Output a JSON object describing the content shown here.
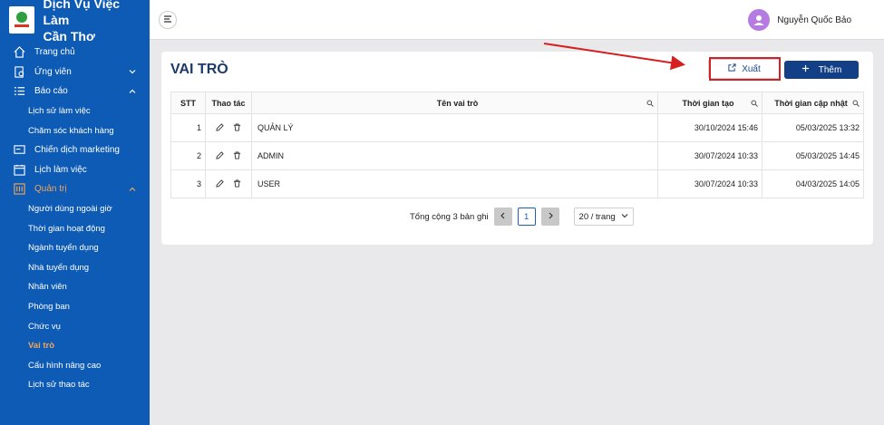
{
  "brand": {
    "title_line1": "Dịch Vụ Việc Làm",
    "title_line2": "Cần Thơ"
  },
  "nav": {
    "items": [
      {
        "label": "Trang chủ",
        "icon": "home-icon"
      },
      {
        "label": "Ứng viên",
        "icon": "candidate-icon"
      },
      {
        "label": "Báo cáo",
        "icon": "list-icon"
      }
    ],
    "report_subitems": [
      "Lịch sử làm việc",
      "Chăm sóc khách hàng"
    ],
    "items2": [
      {
        "label": "Chiến dịch marketing",
        "icon": "campaign-icon"
      },
      {
        "label": "Lịch làm việc",
        "icon": "calendar-icon"
      },
      {
        "label": "Quản trị",
        "icon": "admin-icon"
      }
    ],
    "admin_subitems": [
      "Người dùng ngoài giờ",
      "Thời gian hoạt động",
      "Ngành tuyển dụng",
      "Nhà tuyển dụng",
      "Nhân viên",
      "Phòng ban",
      "Chức vụ",
      "Vai trò",
      "Cấu hình nâng cao",
      "Lịch sử thao tác"
    ]
  },
  "user": {
    "name": "Nguyễn Quốc Bảo"
  },
  "page": {
    "title": "VAI TRÒ",
    "export_label": "Xuất",
    "add_label": "Thêm"
  },
  "table": {
    "headers": {
      "stt": "STT",
      "actions": "Thao tác",
      "name": "Tên vai trò",
      "created": "Thời gian tạo",
      "updated": "Thời gian cập nhật"
    },
    "rows": [
      {
        "stt": "1",
        "name": "QUẢN LÝ",
        "created": "30/10/2024 15:46",
        "updated": "05/03/2025 13:32"
      },
      {
        "stt": "2",
        "name": "ADMIN",
        "created": "30/07/2024 10:33",
        "updated": "05/03/2025 14:45"
      },
      {
        "stt": "3",
        "name": "USER",
        "created": "30/07/2024 10:33",
        "updated": "04/03/2025 14:05"
      }
    ]
  },
  "pager": {
    "total": "Tổng cộng 3 bản ghi",
    "current": "1",
    "page_size": "20 / trang"
  },
  "colors": {
    "sidebar": "#0d5bb5",
    "active": "#f2a65a",
    "primary": "#123f86",
    "highlight": "#d42020"
  }
}
